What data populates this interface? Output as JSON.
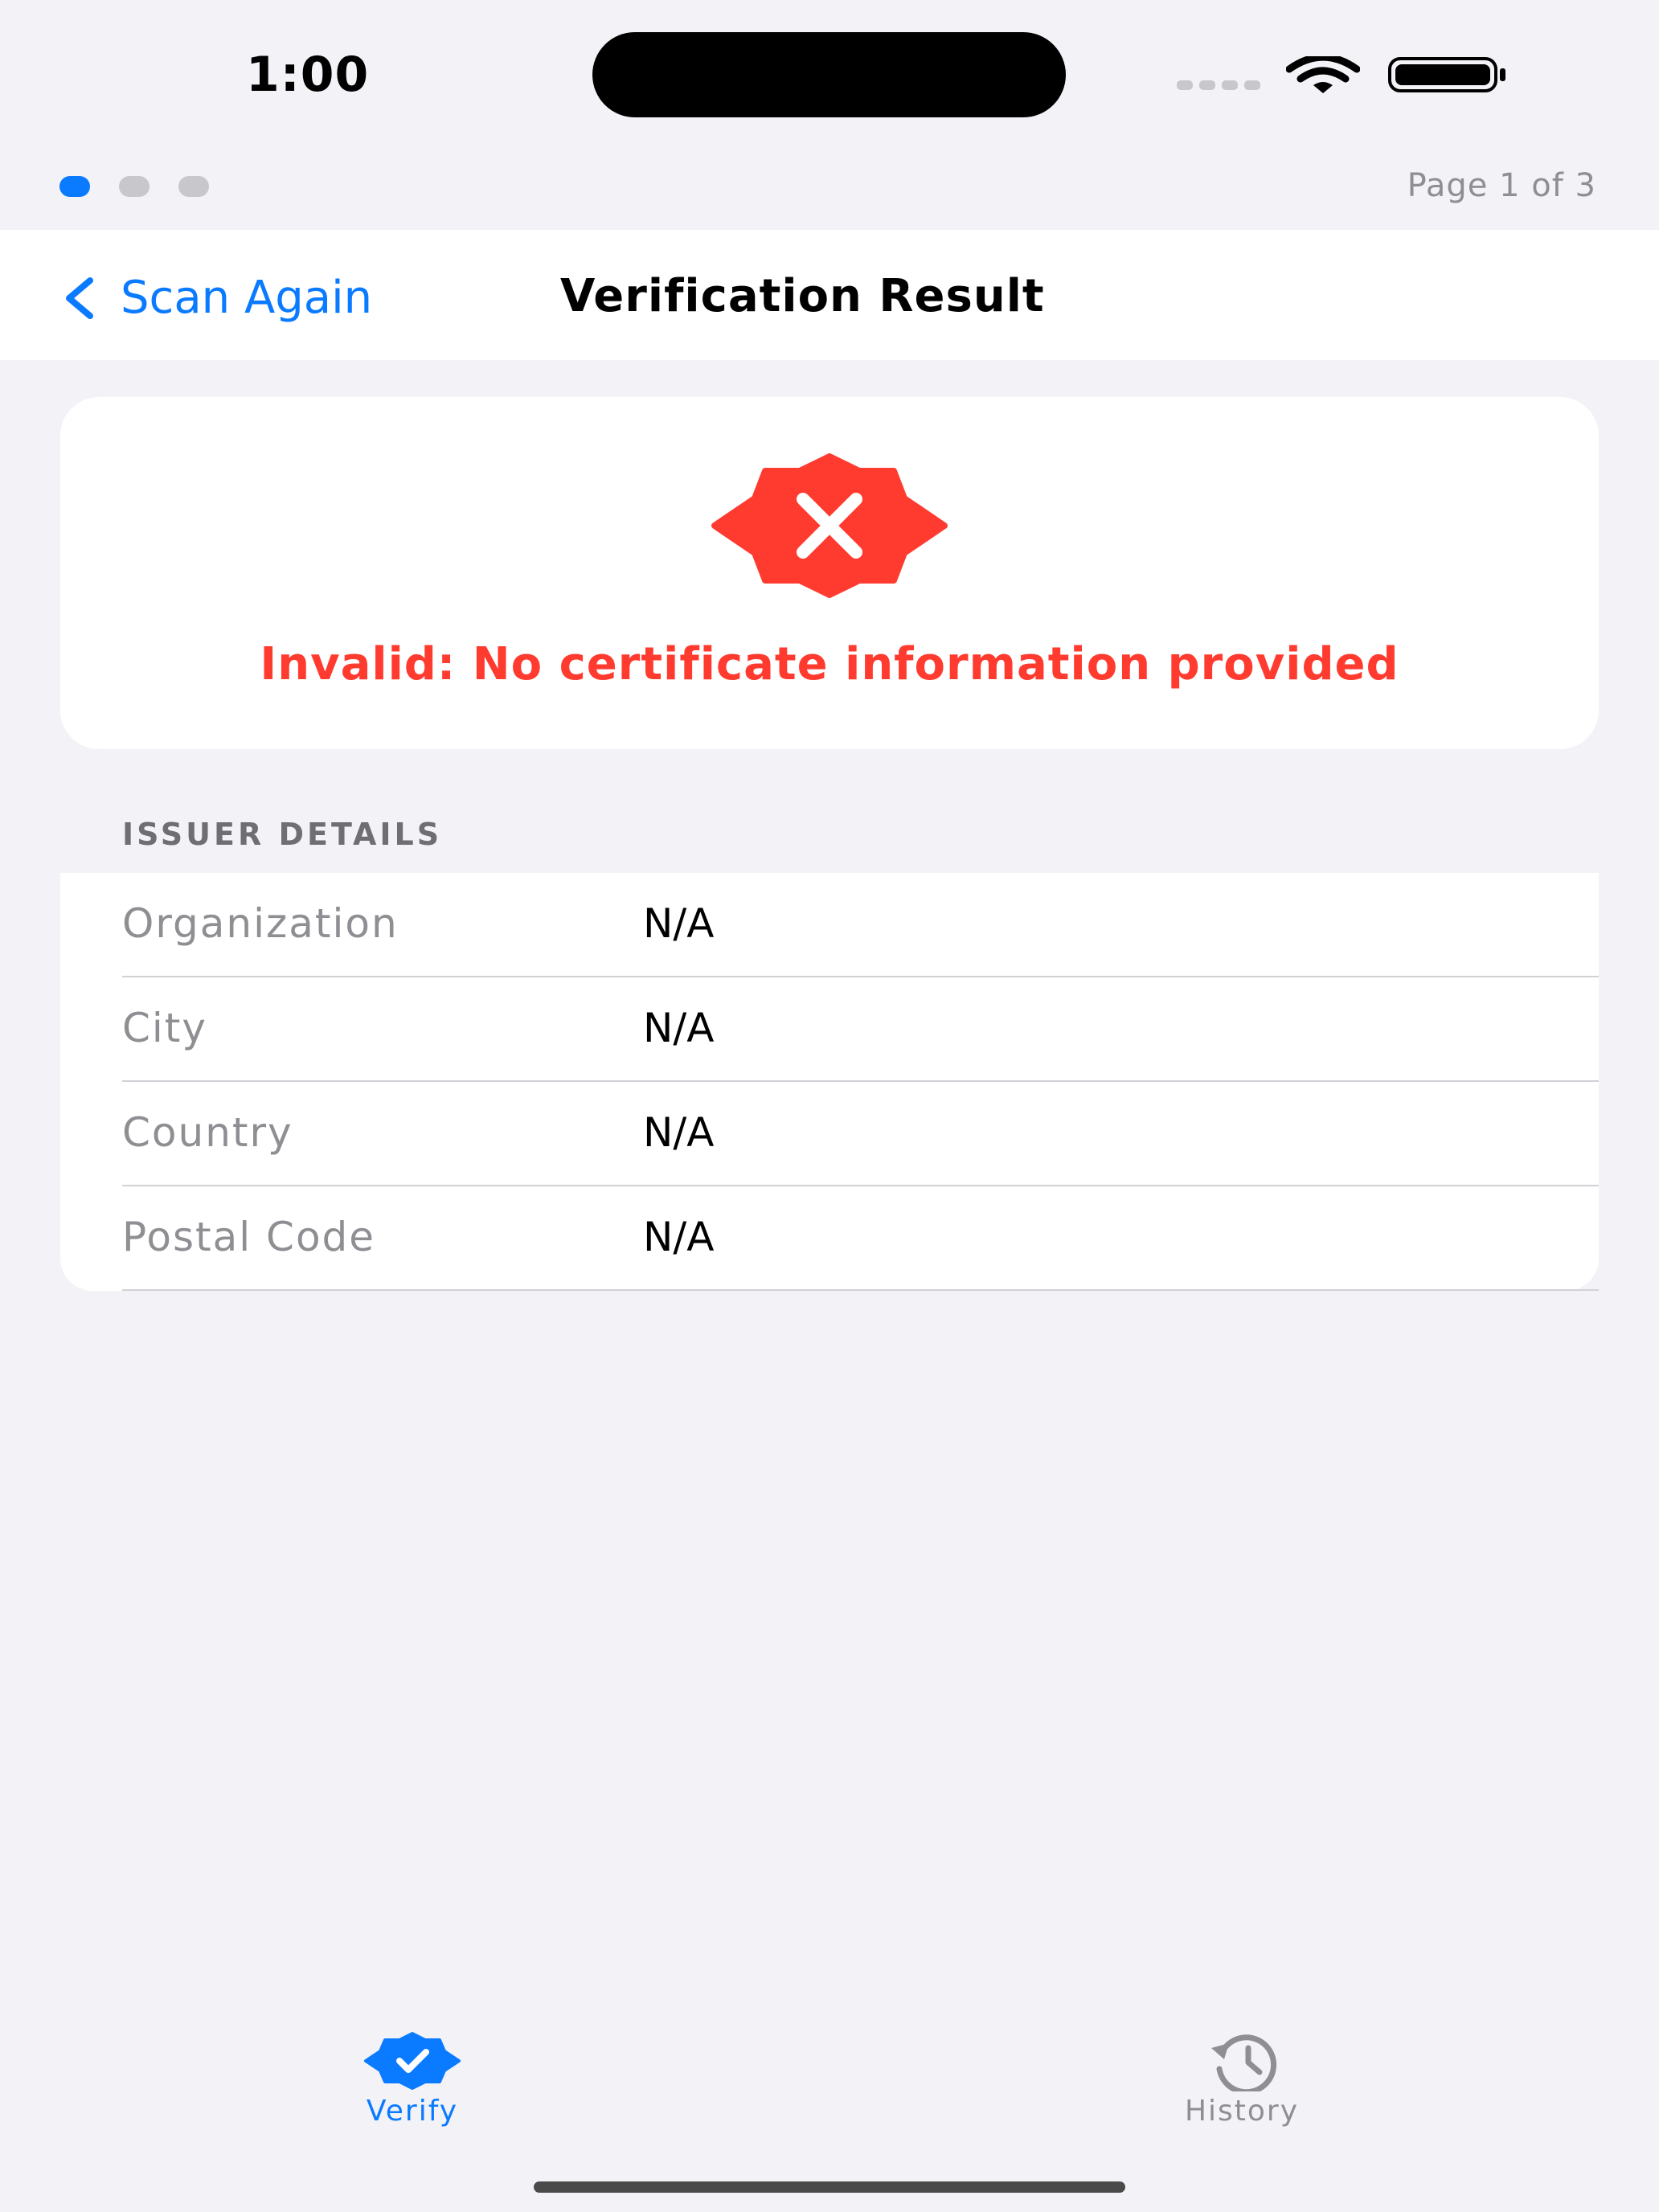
{
  "status_bar": {
    "time": "1:00"
  },
  "pager": {
    "label": "Page 1 of 3",
    "total": 3,
    "current": 1
  },
  "navbar": {
    "back_label": "Scan Again",
    "title": "Verification Result"
  },
  "result": {
    "icon": "xmark-seal-fill-icon",
    "message": "Invalid: No certificate information provided",
    "color": "#ff3b30"
  },
  "issuer": {
    "header": "ISSUER DETAILS",
    "rows": [
      {
        "label": "Organization",
        "value": "N/A"
      },
      {
        "label": "City",
        "value": "N/A"
      },
      {
        "label": "Country",
        "value": "N/A"
      },
      {
        "label": "Postal Code",
        "value": "N/A"
      }
    ]
  },
  "tabbar": {
    "tabs": [
      {
        "label": "Verify",
        "icon": "checkmark-seal-fill-icon",
        "selected": true
      },
      {
        "label": "History",
        "icon": "clock-arrow-circlepath-icon",
        "selected": false
      }
    ]
  },
  "colors": {
    "accent": "#0a7aff",
    "error": "#ff3b30",
    "background": "#f2f2f7"
  }
}
